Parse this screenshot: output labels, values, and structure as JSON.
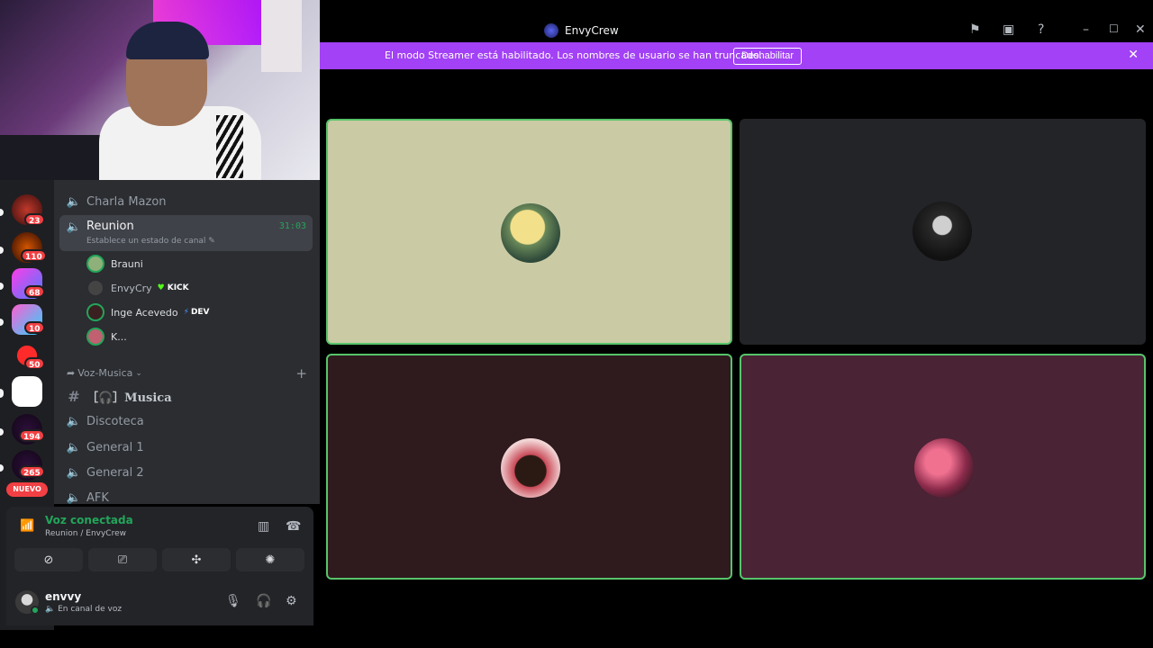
{
  "window": {
    "title": "EnvyCrew"
  },
  "banner": {
    "message": "El modo Streamer está habilitado. Los nombres de usuario se han truncado.",
    "button_label": "Deshabilitar"
  },
  "servers": [
    {
      "badge": "23"
    },
    {
      "badge": "110"
    },
    {
      "badge": "68"
    },
    {
      "badge": "10"
    },
    {
      "badge": "50"
    },
    {
      "badge": ""
    },
    {
      "badge": "194"
    },
    {
      "badge": "265"
    }
  ],
  "new_label": "NUEVO",
  "channels": {
    "charla": "Charla Mazon",
    "active": {
      "name": "Reunion",
      "timer": "31:03",
      "status": "Establece un estado de canal"
    },
    "members": [
      {
        "name": "Brauni",
        "tag": ""
      },
      {
        "name": "EnvyCry",
        "tag": "KICK"
      },
      {
        "name": "Inge Acevedo",
        "tag": "DEV"
      },
      {
        "name": "K...",
        "tag": ""
      }
    ],
    "category": "Voz-Musica",
    "list": [
      "［🎧］Musica",
      "Discoteca",
      "General 1",
      "General 2",
      "AFK"
    ]
  },
  "voice": {
    "status": "Voz conectada",
    "location": "Reunion / EnvyCrew"
  },
  "user": {
    "name": "envvy",
    "status": "En canal de voz"
  },
  "tiles": [
    {
      "bg": "#cacba5",
      "border": "#57c46a"
    },
    {
      "bg": "#232428",
      "border": "#232428"
    },
    {
      "bg": "#2f1a1e",
      "border": "#57c46a"
    },
    {
      "bg": "#4a2335",
      "border": "#57c46a"
    }
  ],
  "colors": {
    "accent_green": "#23a55a",
    "streamer_banner": "#a241f5",
    "notification_red": "#f23f43"
  }
}
